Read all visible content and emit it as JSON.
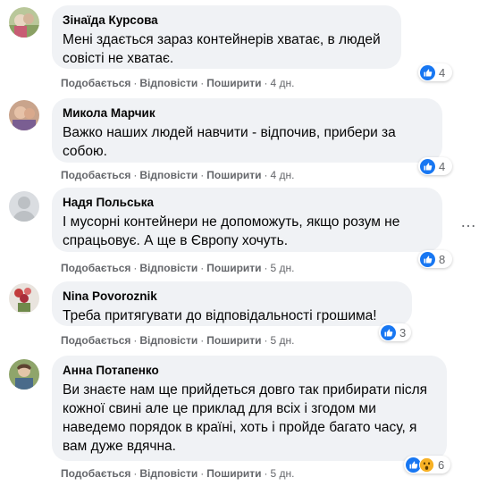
{
  "actions": {
    "like": "Подобається",
    "reply": "Відповісти",
    "share": "Поширити",
    "sep": "·"
  },
  "colors": {
    "bubble": "#f0f2f5",
    "like_blue": "#1877f2",
    "wow_yellow": "#f7b125",
    "meta_gray": "#65676b"
  },
  "comments": [
    {
      "author": "Зінаїда Курсова",
      "text": "Мені здається зараз контейнерів хватає, в людей совісті не хватає.",
      "time": "4 дн.",
      "reactions": [
        "like-icon"
      ],
      "reaction_count": "4"
    },
    {
      "author": "Микола Марчик",
      "text": "Важко наших людей навчити - відпочив, прибери за собою.",
      "time": "4 дн.",
      "reactions": [
        "like-icon"
      ],
      "reaction_count": "4"
    },
    {
      "author": "Надя Польська",
      "text": "І мусорні контейнери не допоможуть, якщо розум не спрацьовує. А ще в Європу хочуть.",
      "time": "5 дн.",
      "reactions": [
        "like-icon"
      ],
      "reaction_count": "8",
      "more_icon": "more-options-icon"
    },
    {
      "author": "Nina Povoroznik",
      "text": "Треба притягувати до відповідальності грошима!",
      "time": "5 дн.",
      "reactions": [
        "like-icon"
      ],
      "reaction_count": "3"
    },
    {
      "author": "Анна Потапенко",
      "text": "Ви знаєте нам ще прийдеться довго так прибирати після кожної свині але це приклад для всіх і згодом ми наведемо порядок в країні, хоть і пройде багато часу, я вам дуже вдячна.",
      "time": "5 дн.",
      "reactions": [
        "like-icon",
        "wow-icon"
      ],
      "reaction_count": "6"
    }
  ]
}
